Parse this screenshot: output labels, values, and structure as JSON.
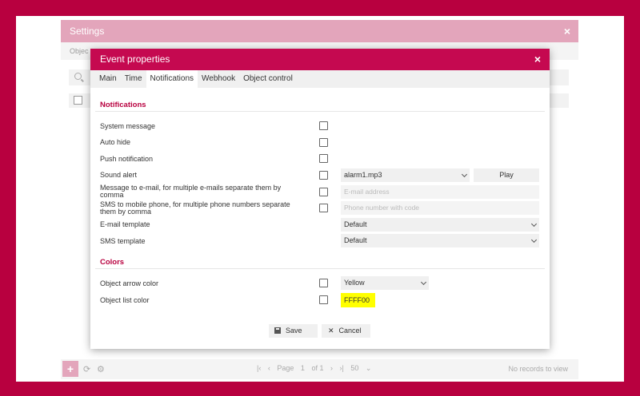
{
  "settings": {
    "title": "Settings",
    "close_icon": "×",
    "tab_partial": "Objec",
    "footer": {
      "add_label": "+",
      "page_label": "Page",
      "page_current": "1",
      "page_of": "of 1",
      "per_page": "50",
      "no_records": "No records to view"
    }
  },
  "modal": {
    "title": "Event properties",
    "close_icon": "×",
    "tabs": [
      "Main",
      "Time",
      "Notifications",
      "Webhook",
      "Object control"
    ],
    "active_tab": "Notifications",
    "notifications": {
      "section_title": "Notifications",
      "system_message": "System message",
      "auto_hide": "Auto hide",
      "push_notification": "Push notification",
      "sound_alert": "Sound alert",
      "sound_file": "alarm1.mp3",
      "play_label": "Play",
      "email_label_1": "Message to e-mail, for multiple e-mails separate them by",
      "email_label_2": "comma",
      "email_placeholder": "E-mail address",
      "sms_label_1": "SMS to mobile phone, for multiple phone numbers separate",
      "sms_label_2": "them by comma",
      "sms_placeholder": "Phone number with code",
      "email_template_label": "E-mail template",
      "email_template_value": "Default",
      "sms_template_label": "SMS template",
      "sms_template_value": "Default"
    },
    "colors": {
      "section_title": "Colors",
      "arrow_color_label": "Object arrow color",
      "arrow_color_value": "Yellow",
      "list_color_label": "Object list color",
      "list_color_value": "FFFF00"
    },
    "buttons": {
      "save": "Save",
      "cancel": "Cancel"
    }
  },
  "theme": {
    "accent": "#c50950",
    "frame": "#b8003f",
    "list_color_swatch": "#ffff00"
  }
}
